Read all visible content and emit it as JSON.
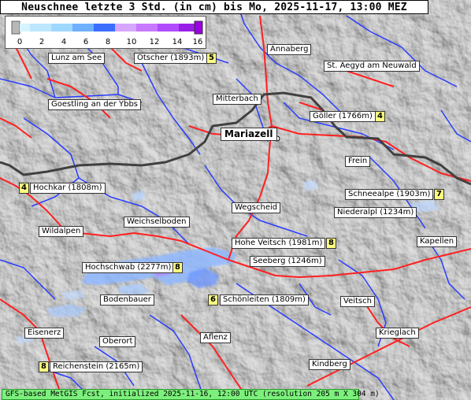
{
  "header": {
    "title": "Neuschnee letzte 3 Std. (in cm) bis Mo, 2025-11-17, 13:00 MEZ"
  },
  "legend": {
    "ticks": [
      "0",
      "2",
      "4",
      "6",
      "8",
      "10",
      "12",
      "14",
      "16"
    ],
    "colors": [
      "#c8c8c8",
      "#d6f4ff",
      "#9fd8ff",
      "#6fb0ff",
      "#3b6eff",
      "#d7a6ff",
      "#c779ff",
      "#b04bff",
      "#9a1fe6"
    ]
  },
  "places": {
    "lunz": "Lunz am See",
    "oetscher": "Ötscher (1893m)",
    "annaberg": "Annaberg",
    "aegyd": "St. Aegyd am Neuwald",
    "goestling": "Goestling an der Ybbs",
    "mitterbach": "Mitterbach",
    "mariazell": "Mariazell",
    "goeller": "Göller (1766m)",
    "frein": "Frein",
    "hochkar": "Hochkar (1808m)",
    "schneealpe": "Schneealpe (1903m)",
    "wegscheid": "Wegscheid",
    "niederalpl": "Niederalpl (1234m)",
    "weichselboden": "Weichselboden",
    "wildalpen": "Wildalpen",
    "hoheveitsch": "Hohe Veitsch (1981m)",
    "kapellen": "Kapellen",
    "seeberg": "Seeberg (1246m)",
    "hochschwab": "Hochschwab (2277m)",
    "bodenbauer": "Bodenbauer",
    "schoenleiten": "Schönleiten (1809m)",
    "veitsch": "Veitsch",
    "eisenerz": "Eisenerz",
    "oberort": "Oberort",
    "aflenz": "Aflenz",
    "krieglach": "Krieglach",
    "reichenstein": "Reichenstein (2165m)",
    "kindberg": "Kindberg"
  },
  "badges": {
    "oetscher": "5",
    "goeller": "4",
    "hochkar": "4",
    "schneealpe": "7",
    "hoheveitsch": "8",
    "hochschwab": "8",
    "schoenleiten": "6",
    "reichenstein": "8"
  },
  "footer": {
    "text": "GFS-based MetGIS Fcst, initialized 2025-11-16, 12:00 UTC  (resolution 205 m X 304 m)"
  },
  "colors": {
    "rivers": "#2a3cff",
    "roads": "#ff2020",
    "border": "#404040",
    "snow": "#7aa8ff"
  }
}
